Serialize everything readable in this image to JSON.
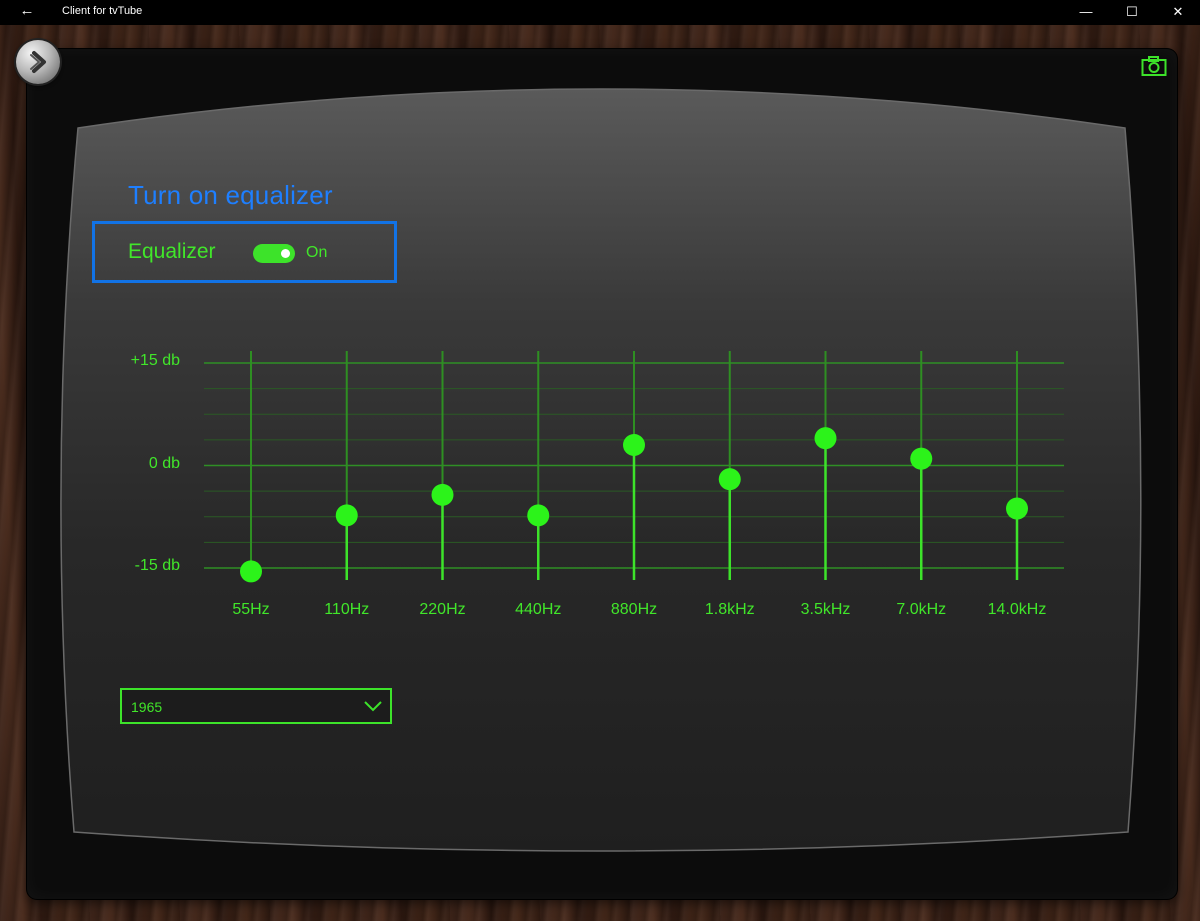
{
  "window": {
    "title": "Client for tvTube",
    "back_glyph": "←",
    "minimize_glyph": "—",
    "maximize_glyph": "☐",
    "close_glyph": "✕"
  },
  "icons": {
    "nav": "chevron-right-icon",
    "camera": "camera-icon"
  },
  "colors": {
    "accent_green": "#3de32a",
    "title_blue": "#1e7fff",
    "highlight_blue": "#1273e6"
  },
  "section_title": "Turn on equalizer",
  "equalizer": {
    "label": "Equalizer",
    "toggle_on": true,
    "state_text": "On"
  },
  "db_labels": [
    "+15 db",
    "0 db",
    "-15 db"
  ],
  "bands": [
    {
      "freq": "55Hz",
      "gain": -15.5
    },
    {
      "freq": "110Hz",
      "gain": -7.3
    },
    {
      "freq": "220Hz",
      "gain": -4.3
    },
    {
      "freq": "440Hz",
      "gain": -7.3
    },
    {
      "freq": "880Hz",
      "gain": 3.0
    },
    {
      "freq": "1.8kHz",
      "gain": -2.0
    },
    {
      "freq": "3.5kHz",
      "gain": 4.0
    },
    {
      "freq": "7.0kHz",
      "gain": 1.0
    },
    {
      "freq": "14.0kHz",
      "gain": -6.3
    }
  ],
  "gain_range": [
    -15,
    15
  ],
  "preset": {
    "value": "1965"
  }
}
